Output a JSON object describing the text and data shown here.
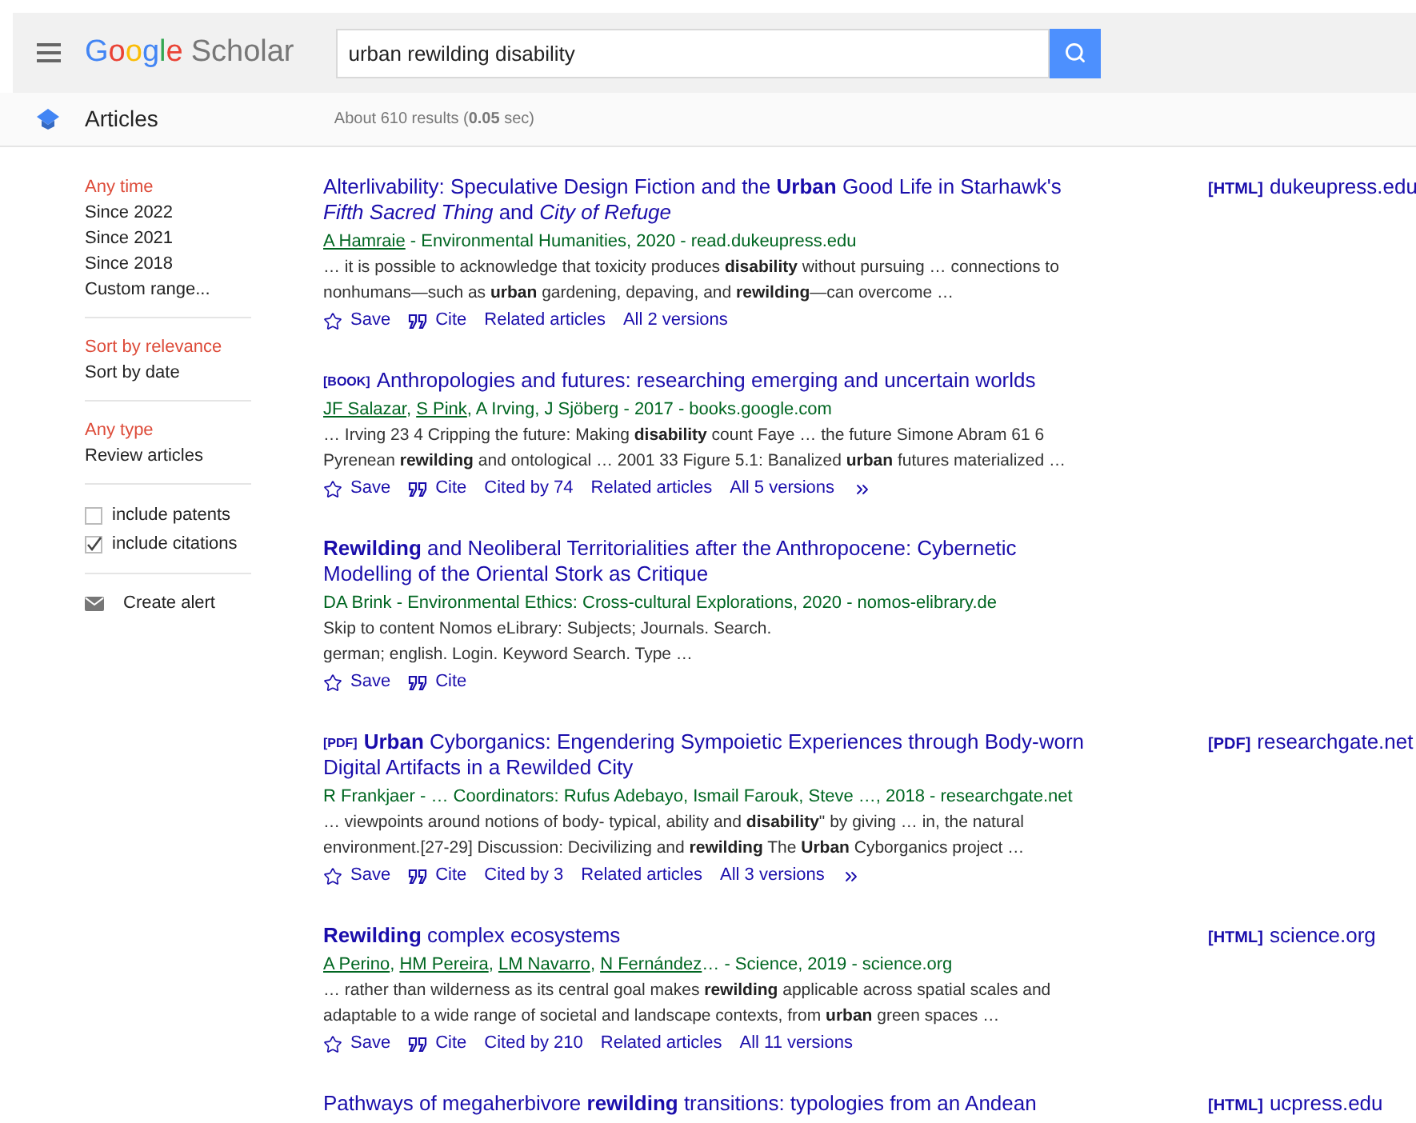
{
  "header": {
    "logo": {
      "brand": "Google",
      "product": "Scholar"
    },
    "search": {
      "value": "urban rewilding disability"
    }
  },
  "subbar": {
    "section": "Articles",
    "stats": "About 610 results (**0.05** sec)"
  },
  "sidebar": {
    "groups": [
      {
        "kind": "options",
        "items": [
          {
            "label": "Any time",
            "selected": true
          },
          {
            "label": "Since 2022",
            "selected": false
          },
          {
            "label": "Since 2021",
            "selected": false
          },
          {
            "label": "Since 2018",
            "selected": false
          },
          {
            "label": "Custom range...",
            "selected": false
          }
        ]
      },
      {
        "kind": "options",
        "items": [
          {
            "label": "Sort by relevance",
            "selected": true
          },
          {
            "label": "Sort by date",
            "selected": false
          }
        ]
      },
      {
        "kind": "options",
        "items": [
          {
            "label": "Any type",
            "selected": true
          },
          {
            "label": "Review articles",
            "selected": false
          }
        ]
      },
      {
        "kind": "checkboxes",
        "items": [
          {
            "label": "include patents",
            "checked": false
          },
          {
            "label": "include citations",
            "checked": true
          }
        ]
      },
      {
        "kind": "alert",
        "items": [
          {
            "label": "Create alert"
          }
        ]
      }
    ]
  },
  "results": [
    {
      "title": "Alterlivability: Speculative Design Fiction and the **Urban** Good Life in Starhawk's *Fifth Sacred Thing* and *City of Refuge*",
      "byline": [
        {
          "text": "A Hamraie",
          "linked": true
        },
        {
          "text": " - Environmental Humanities, 2020 - read.dukeupress.edu",
          "linked": false
        }
      ],
      "snippet": "… it is possible to acknowledge that toxicity produces **disability** without pursuing … connections to nonhumans—such as **urban** gardening, depaving, and **rewilding**—can overcome …",
      "actions": [
        {
          "kind": "save",
          "label": "Save"
        },
        {
          "kind": "cite",
          "label": "Cite"
        },
        {
          "kind": "link",
          "label": "Related articles"
        },
        {
          "kind": "link",
          "label": "All 2 versions"
        }
      ],
      "side_link": {
        "format": "[HTML]",
        "domain": "dukeupress.edu"
      }
    },
    {
      "type_tag": "[BOOK]",
      "title": "Anthropologies and futures: researching emerging and uncertain worlds",
      "byline": [
        {
          "text": "JF Salazar",
          "linked": true
        },
        {
          "text": ", ",
          "linked": false
        },
        {
          "text": "S Pink",
          "linked": true
        },
        {
          "text": ", A Irving, J Sjöberg - 2017 - books.google.com",
          "linked": false
        }
      ],
      "snippet": "… Irving 23 4 Cripping the future: Making **disability** count Faye … the future Simone Abram 61 6 Pyrenean **rewilding** and ontological … 2001 33 Figure 5.1: Banalized **urban** futures materialized …",
      "actions": [
        {
          "kind": "save",
          "label": "Save"
        },
        {
          "kind": "cite",
          "label": "Cite"
        },
        {
          "kind": "link",
          "label": "Cited by 74"
        },
        {
          "kind": "link",
          "label": "Related articles"
        },
        {
          "kind": "link",
          "label": "All 5 versions"
        },
        {
          "kind": "more"
        }
      ]
    },
    {
      "title": "**Rewilding** and Neoliberal Territorialities after the Anthropocene: Cybernetic Modelling of the Oriental Stork as Critique",
      "byline": [
        {
          "text": "DA Brink - Environmental Ethics: Cross-cultural Explorations, 2020 - nomos-elibrary.de",
          "linked": false
        }
      ],
      "snippet_lines": [
        "Skip to content Nomos eLibrary: Subjects; Journals. Search.",
        "german; english. Login. Keyword Search. Type …"
      ],
      "actions": [
        {
          "kind": "save",
          "label": "Save"
        },
        {
          "kind": "cite",
          "label": "Cite"
        }
      ]
    },
    {
      "type_tag": "[PDF]",
      "title": "**Urban** Cyborganics: Engendering Sympoietic Experiences through Body-worn Digital Artifacts in a Rewilded City",
      "byline": [
        {
          "text": "R Frankjaer - … Coordinators: Rufus Adebayo, Ismail Farouk, Steve …, 2018 - researchgate.net",
          "linked": false
        }
      ],
      "snippet": "… viewpoints around notions of body- typical, ability and **disability**\" by giving … in, the natural environment.[27-29] Discussion: Decivilizing and **rewilding** The **Urban** Cyborganics project …",
      "actions": [
        {
          "kind": "save",
          "label": "Save"
        },
        {
          "kind": "cite",
          "label": "Cite"
        },
        {
          "kind": "link",
          "label": "Cited by 3"
        },
        {
          "kind": "link",
          "label": "Related articles"
        },
        {
          "kind": "link",
          "label": "All 3 versions"
        },
        {
          "kind": "more"
        }
      ],
      "side_link": {
        "format": "[PDF]",
        "domain": "researchgate.net"
      }
    },
    {
      "title": "**Rewilding** complex ecosystems",
      "byline": [
        {
          "text": "A Perino",
          "linked": true
        },
        {
          "text": ", ",
          "linked": false
        },
        {
          "text": "HM Pereira",
          "linked": true
        },
        {
          "text": ", ",
          "linked": false
        },
        {
          "text": "LM Navarro",
          "linked": true
        },
        {
          "text": ", ",
          "linked": false
        },
        {
          "text": "N Fernández",
          "linked": true
        },
        {
          "text": "… - Science, 2019 - science.org",
          "linked": false
        }
      ],
      "snippet": "… rather than wilderness as its central goal makes **rewilding** applicable across spatial scales and adaptable to a wide range of societal and landscape contexts, from **urban** green spaces …",
      "actions": [
        {
          "kind": "save",
          "label": "Save"
        },
        {
          "kind": "cite",
          "label": "Cite"
        },
        {
          "kind": "link",
          "label": "Cited by 210"
        },
        {
          "kind": "link",
          "label": "Related articles"
        },
        {
          "kind": "link",
          "label": "All 11 versions"
        }
      ],
      "side_link": {
        "format": "[HTML]",
        "domain": "science.org"
      }
    },
    {
      "title": "Pathways of megaherbivore **rewilding** transitions: typologies from an Andean",
      "side_link": {
        "format": "[HTML]",
        "domain": "ucpress.edu"
      }
    }
  ]
}
